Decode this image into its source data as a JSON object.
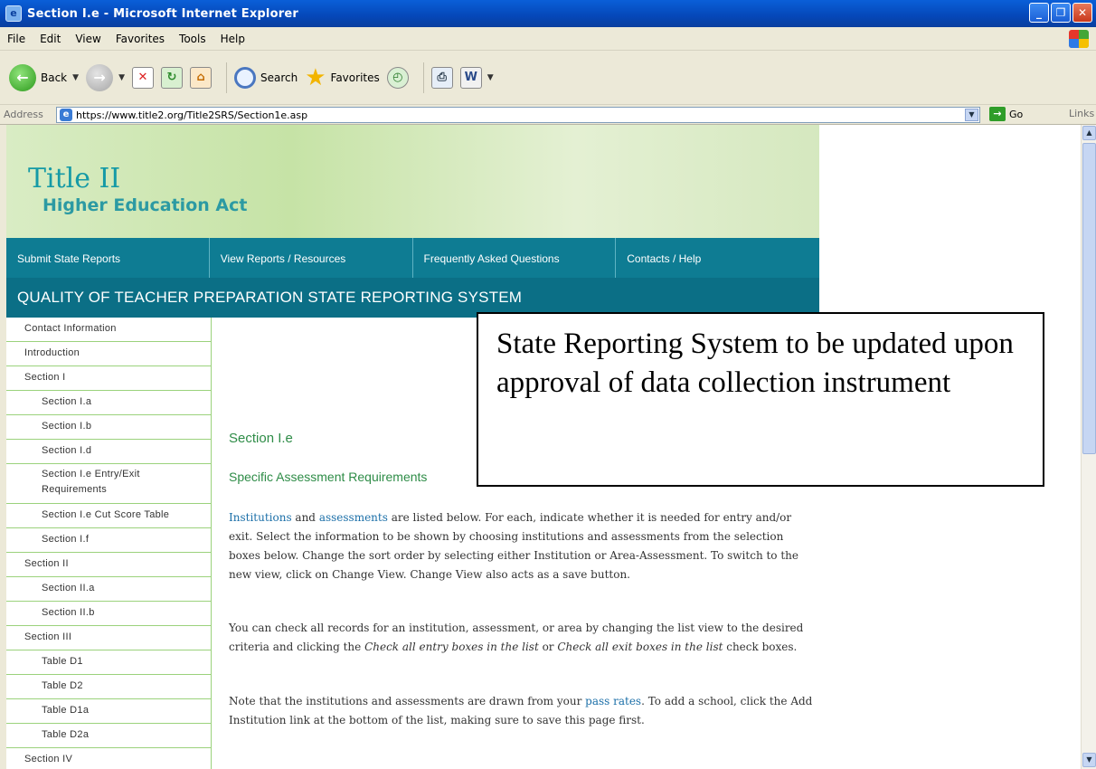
{
  "window": {
    "title": "Section I.e - Microsoft Internet Explorer"
  },
  "menu": [
    "File",
    "Edit",
    "View",
    "Favorites",
    "Tools",
    "Help"
  ],
  "toolbar": {
    "back": "Back",
    "search": "Search",
    "favorites": "Favorites"
  },
  "address": {
    "label": "Address",
    "url": "https://www.title2.org/Title2SRS/Section1e.asp",
    "go": "Go",
    "links": "Links"
  },
  "site": {
    "logo_title": "Title II",
    "logo_sub": "Higher Education Act",
    "nav": [
      "Submit State Reports",
      "View Reports / Resources",
      "Frequently Asked Questions",
      "Contacts / Help"
    ],
    "system_title": "QUALITY OF TEACHER PREPARATION STATE REPORTING SYSTEM"
  },
  "sidebar": [
    "Contact Information",
    "Introduction",
    "Section I",
    "Section I.a",
    "Section I.b",
    "Section I.d",
    "Section I.e Entry/Exit Requirements",
    "Section I.e Cut Score Table",
    "Section I.f",
    "Section II",
    "Section II.a",
    "Section II.b",
    "Section III",
    "Table D1",
    "Table D2",
    "Table D1a",
    "Table D2a",
    "Section IV"
  ],
  "content": {
    "title": "Section I.e",
    "subtitle": "Specific Assessment Requirements",
    "p1_link1": "Institutions",
    "p1_and": " and ",
    "p1_link2": "assessments",
    "p1_text": " are listed below. For each, indicate whether it is needed for entry and/or exit. Select the information to be shown by choosing institutions and assessments from the selection boxes below. Change the sort order by selecting either Institution or Area-Assessment. To switch to the new view, click on Change View. Change View also acts as a save button.",
    "p2_a": "You can check all records for an institution, assessment, or area by changing the list view to the desired criteria and clicking the ",
    "p2_em1": "Check all entry boxes in the list",
    "p2_or": " or ",
    "p2_em2": "Check all exit boxes in the list",
    "p2_b": " check boxes.",
    "p3_a": "Note that the institutions and assessments are drawn from your ",
    "p3_link": "pass rates",
    "p3_b": ". To add a school, click the Add Institution link at the bottom of the list, making sure to save this page first."
  },
  "callout": {
    "text": "State Reporting System to be updated upon approval of data collection instrument"
  }
}
